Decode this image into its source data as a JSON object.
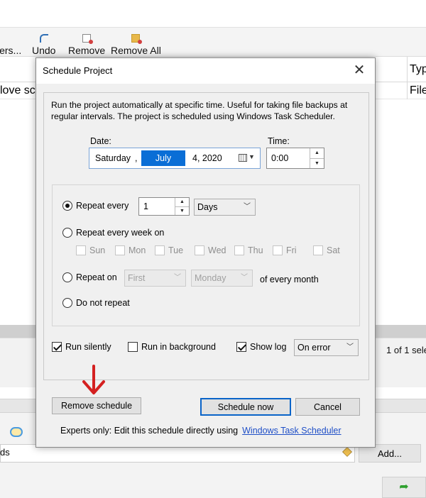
{
  "toolbar": {
    "partial_label": "lers...",
    "undo_label": "Undo",
    "remove_label": "Remove",
    "remove_all_label": "Remove All"
  },
  "list": {
    "header_right": "Typ",
    "row_left": "love sc",
    "row_right": "File"
  },
  "status": {
    "selection": "1 of 1 sele"
  },
  "footer": {
    "field_text": "ds",
    "add_button": "Add..."
  },
  "dialog": {
    "title": "Schedule Project",
    "description": "Run the project automatically at specific time. Useful for taking file backups at regular intervals. The project is scheduled using Windows Task Scheduler.",
    "date_label": "Date:",
    "time_label": "Time:",
    "date": {
      "weekday": "Saturday",
      "sep": ",",
      "month": "July",
      "day_year": "4, 2020"
    },
    "time_value": "0:00",
    "repeat_every": {
      "label": "Repeat every",
      "value": "1",
      "unit": "Days",
      "selected": true
    },
    "repeat_week": {
      "label": "Repeat every week on",
      "days": [
        "Sun",
        "Mon",
        "Tue",
        "Wed",
        "Thu",
        "Fri",
        "Sat"
      ]
    },
    "repeat_on": {
      "label": "Repeat on",
      "ordinal": "First",
      "weekday": "Monday",
      "suffix": "of every month"
    },
    "no_repeat": {
      "label": "Do not repeat"
    },
    "run_silently": {
      "label": "Run silently",
      "checked": true
    },
    "run_background": {
      "label": "Run in background",
      "checked": false
    },
    "show_log": {
      "label": "Show log",
      "checked": true,
      "mode": "On error"
    },
    "buttons": {
      "remove": "Remove schedule",
      "schedule_now": "Schedule now",
      "cancel": "Cancel"
    },
    "experts": {
      "text": "Experts only: Edit this schedule directly using",
      "link": "Windows Task Scheduler"
    }
  },
  "colors": {
    "accent": "#0a6ed6",
    "link": "#1f4fc7",
    "annotation_arrow": "#d42020"
  }
}
